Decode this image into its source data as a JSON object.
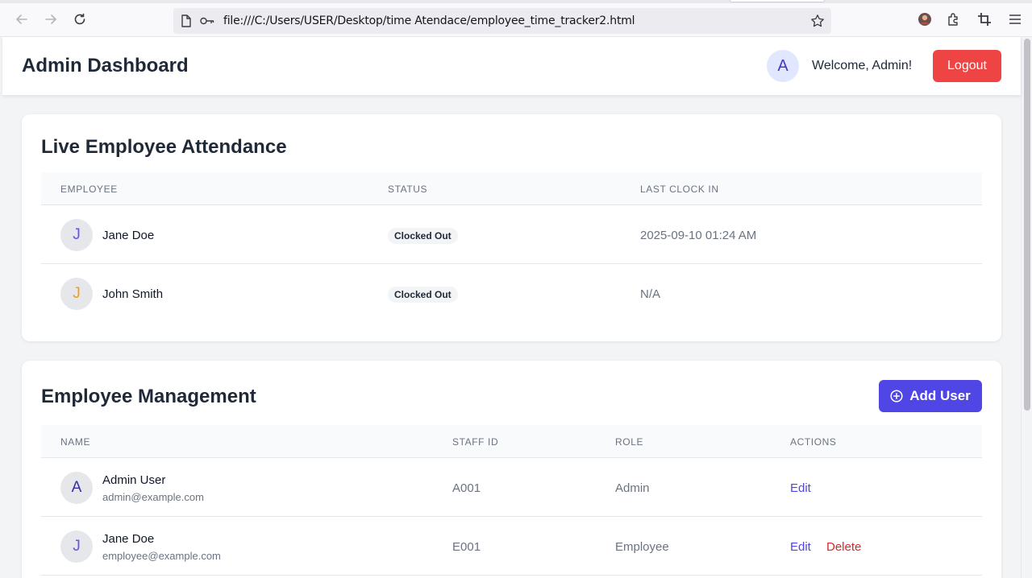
{
  "browser": {
    "url": "file:///C:/Users/USER/Desktop/time Atendace/employee_time_tracker2.html"
  },
  "header": {
    "title": "Admin Dashboard",
    "avatar_initial": "A",
    "welcome": "Welcome, Admin!",
    "logout_label": "Logout"
  },
  "attendance": {
    "title": "Live Employee Attendance",
    "columns": [
      "EMPLOYEE",
      "STATUS",
      "LAST CLOCK IN"
    ],
    "rows": [
      {
        "initial": "J",
        "initial_color": "#6d4ee6",
        "name": "Jane Doe",
        "status": "Clocked Out",
        "last_clock_in": "2025-09-10 01:24 AM"
      },
      {
        "initial": "J",
        "initial_color": "#f59e0b",
        "name": "John Smith",
        "status": "Clocked Out",
        "last_clock_in": "N/A"
      }
    ]
  },
  "management": {
    "title": "Employee Management",
    "add_user_label": "Add User",
    "columns": [
      "NAME",
      "STAFF ID",
      "ROLE",
      "ACTIONS"
    ],
    "rows": [
      {
        "initial": "A",
        "initial_color": "#3730a3",
        "name": "Admin User",
        "email": "admin@example.com",
        "staff_id": "A001",
        "role": "Admin",
        "edit_label": "Edit",
        "delete_label": ""
      },
      {
        "initial": "J",
        "initial_color": "#6d4ee6",
        "name": "Jane Doe",
        "email": "employee@example.com",
        "staff_id": "E001",
        "role": "Employee",
        "edit_label": "Edit",
        "delete_label": "Delete"
      }
    ]
  },
  "colors": {
    "accent": "#4f46e5",
    "danger": "#ef4444"
  }
}
